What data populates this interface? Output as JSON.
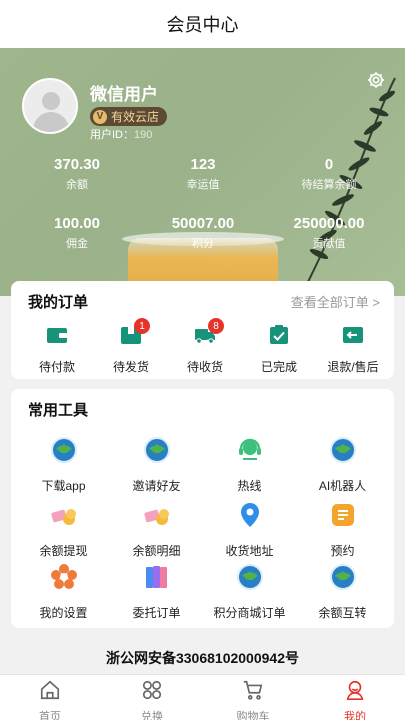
{
  "header": {
    "title": "会员中心"
  },
  "profile": {
    "name": "微信用户",
    "badge": "有效云店",
    "user_id_label": "用户ID：",
    "user_id_value": "190"
  },
  "stats": [
    {
      "value": "370.30",
      "label": "余额"
    },
    {
      "value": "123",
      "label": "幸运值"
    },
    {
      "value": "0",
      "label": "待结算余额"
    },
    {
      "value": "100.00",
      "label": "佣金"
    },
    {
      "value": "50007.00",
      "label": "积分"
    },
    {
      "value": "250000.00",
      "label": "贡献值"
    }
  ],
  "orders": {
    "title": "我的订单",
    "view_all": "查看全部订单 >",
    "items": [
      {
        "label": "待付款",
        "icon": "wallet-icon",
        "badge": ""
      },
      {
        "label": "待发货",
        "icon": "package-icon",
        "badge": "1"
      },
      {
        "label": "待收货",
        "icon": "truck-icon",
        "badge": "8"
      },
      {
        "label": "已完成",
        "icon": "clipboard-check-icon",
        "badge": ""
      },
      {
        "label": "退款/售后",
        "icon": "refund-icon",
        "badge": ""
      }
    ]
  },
  "tools": {
    "title": "常用工具",
    "items": [
      {
        "label": "下载app",
        "icon": "download-app-icon"
      },
      {
        "label": "邀请好友",
        "icon": "invite-friends-icon"
      },
      {
        "label": "热线",
        "icon": "hotline-icon"
      },
      {
        "label": "AI机器人",
        "icon": "ai-robot-icon"
      },
      {
        "label": "余额提现",
        "icon": "withdraw-icon"
      },
      {
        "label": "余额明细",
        "icon": "balance-detail-icon"
      },
      {
        "label": "收货地址",
        "icon": "location-pin-icon"
      },
      {
        "label": "预约",
        "icon": "booking-icon"
      },
      {
        "label": "我的设置",
        "icon": "settings-flower-icon"
      },
      {
        "label": "委托订单",
        "icon": "consign-order-icon"
      },
      {
        "label": "积分商城订单",
        "icon": "points-mall-icon"
      },
      {
        "label": "余额互转",
        "icon": "balance-transfer-icon"
      }
    ]
  },
  "footer_note": "浙公网安备33068102000942号",
  "tabbar": [
    {
      "label": "首页",
      "icon": "home-icon"
    },
    {
      "label": "兑换",
      "icon": "grid-icon"
    },
    {
      "label": "购物车",
      "icon": "cart-icon"
    },
    {
      "label": "我的",
      "icon": "profile-icon"
    }
  ],
  "colors": {
    "accent": "#e5352b",
    "teal": "#17937c",
    "hero_green": "#9fb68d"
  }
}
